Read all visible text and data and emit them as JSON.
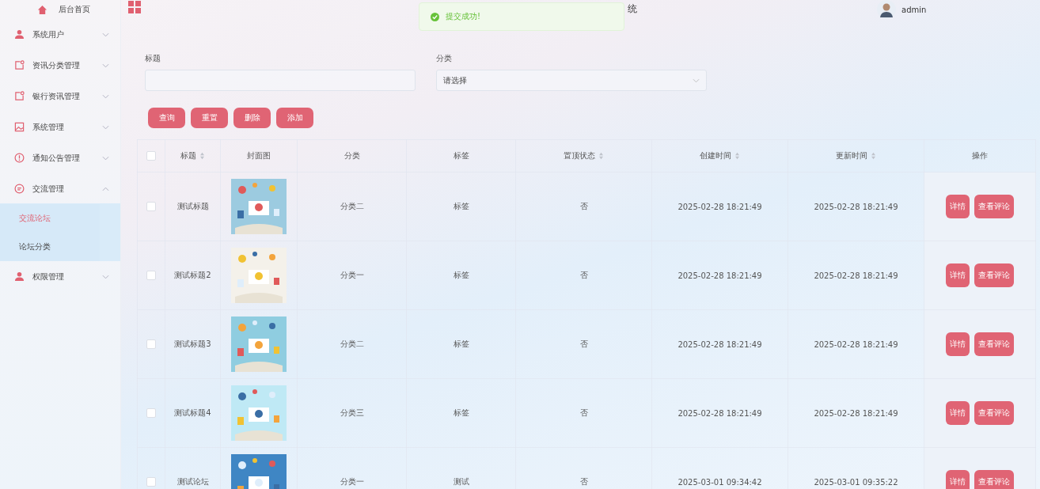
{
  "sidebar": {
    "home": {
      "label": "后台首页"
    },
    "items": [
      {
        "label": "系统用户",
        "expanded": false
      },
      {
        "label": "资讯分类管理",
        "expanded": false
      },
      {
        "label": "银行资讯管理",
        "expanded": false
      },
      {
        "label": "系统管理",
        "expanded": false
      },
      {
        "label": "通知公告管理",
        "expanded": false
      },
      {
        "label": "交流管理",
        "expanded": true,
        "children": [
          {
            "label": "交流论坛",
            "selected": true
          },
          {
            "label": "论坛分类",
            "selected": false
          }
        ]
      },
      {
        "label": "权限管理",
        "expanded": false
      }
    ]
  },
  "header": {
    "title": "统",
    "user": "admin"
  },
  "toast": {
    "message": "提交成功!"
  },
  "filters": [
    {
      "kind": "input",
      "label": "标题"
    },
    {
      "kind": "select",
      "label": "分类",
      "value": "请选择"
    }
  ],
  "buttons": [
    "查询",
    "重置",
    "删除",
    "添加"
  ],
  "table": {
    "all_checked": false,
    "columns": [
      {
        "label": "标题",
        "sortable": true
      },
      {
        "label": "封面图",
        "sortable": false
      },
      {
        "label": "分类",
        "sortable": false
      },
      {
        "label": "标签",
        "sortable": false
      },
      {
        "label": "置顶状态",
        "sortable": true
      },
      {
        "label": "创建时间",
        "sortable": true
      },
      {
        "label": "更新时间",
        "sortable": true
      },
      {
        "label": "操作",
        "sortable": false
      }
    ],
    "rows": [
      {
        "checked": false,
        "title": "测试标题",
        "category": "分类二",
        "tag": "标签",
        "pinned": "否",
        "created": "2025-02-28 18:21:49",
        "updated": "2025-02-28 18:21:49",
        "actions": [
          "详情",
          "查看评论"
        ]
      },
      {
        "checked": false,
        "title": "测试标题2",
        "category": "分类一",
        "tag": "标签",
        "pinned": "否",
        "created": "2025-02-28 18:21:49",
        "updated": "2025-02-28 18:21:49",
        "actions": [
          "详情",
          "查看评论"
        ]
      },
      {
        "checked": false,
        "title": "测试标题3",
        "category": "分类二",
        "tag": "标签",
        "pinned": "否",
        "created": "2025-02-28 18:21:49",
        "updated": "2025-02-28 18:21:49",
        "actions": [
          "详情",
          "查看评论"
        ]
      },
      {
        "checked": false,
        "title": "测试标题4",
        "category": "分类三",
        "tag": "标签",
        "pinned": "否",
        "created": "2025-02-28 18:21:49",
        "updated": "2025-02-28 18:21:49",
        "actions": [
          "详情",
          "查看评论"
        ]
      },
      {
        "checked": false,
        "title": "测试论坛",
        "category": "分类一",
        "tag": "测试",
        "pinned": "否",
        "created": "2025-03-01 09:34:42",
        "updated": "2025-03-01 09:35:22",
        "actions": [
          "详情",
          "查看评论"
        ]
      }
    ]
  }
}
